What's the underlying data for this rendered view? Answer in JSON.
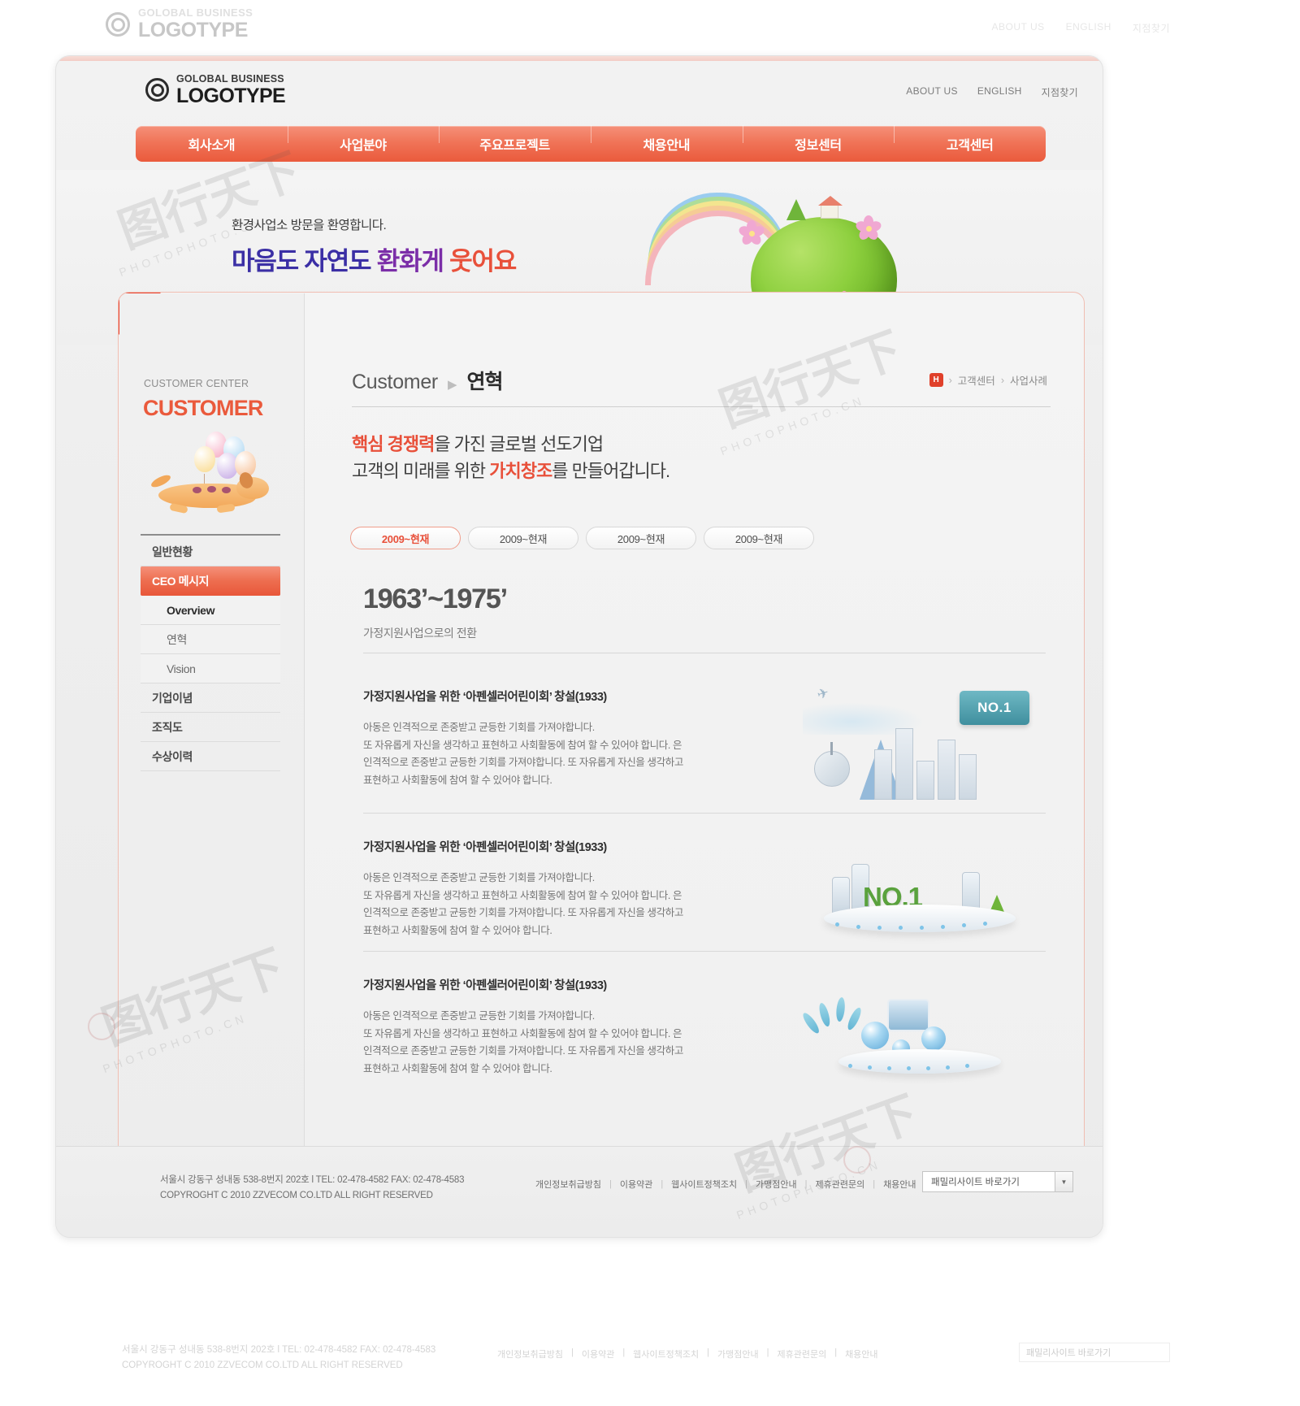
{
  "brand": {
    "logo_sub": "GOLOBAL BUSINESS",
    "logo_main": "LOGOTYPE",
    "accent": "#ea5a3c",
    "accent_dark": "#e0402a"
  },
  "toplinks": [
    {
      "label": "ABOUT US"
    },
    {
      "label": "ENGLISH"
    },
    {
      "label": "지점찾기"
    }
  ],
  "gnb": [
    {
      "label": "회사소개"
    },
    {
      "label": "사업분야"
    },
    {
      "label": "주요프로젝트"
    },
    {
      "label": "채용안내"
    },
    {
      "label": "정보센터"
    },
    {
      "label": "고객센터"
    }
  ],
  "hero": {
    "line1": "환경사업소 방문을 환영합니다.",
    "word1": "마음도",
    "word2": "자연도",
    "word3": "환화게",
    "word4": "웃어요"
  },
  "sidebar": {
    "eyebrow": "CUSTOMER CENTER",
    "title": "CUSTOMER",
    "items": [
      {
        "label": "일반현황",
        "kind": "top"
      },
      {
        "label": "CEO 메시지",
        "kind": "active"
      },
      {
        "label": "Overview",
        "kind": "sub-current"
      },
      {
        "label": "연혁",
        "kind": "sub"
      },
      {
        "label": "Vision",
        "kind": "sub"
      },
      {
        "label": "기업이념",
        "kind": "top"
      },
      {
        "label": "조직도",
        "kind": "top"
      },
      {
        "label": "수상이력",
        "kind": "top"
      }
    ]
  },
  "page": {
    "title_en": "Customer",
    "title_arrow": "▶",
    "title_ko": "연혁",
    "breadcrumb": {
      "home_glyph": "H",
      "sep": "›",
      "items": [
        "고객센터",
        "사업사례"
      ]
    },
    "intro": {
      "l1_red": "핵심 경쟁력",
      "l1_rest": "을 가진 글로벌 선도기업",
      "l2_pre": "고객의 미래를 위한 ",
      "l2_red": "가치창조",
      "l2_rest": "를 만들어갑니다."
    },
    "pills": [
      {
        "label": "2009~현재",
        "active": true
      },
      {
        "label": "2009~현재",
        "active": false
      },
      {
        "label": "2009~현재",
        "active": false
      },
      {
        "label": "2009~현재",
        "active": false
      }
    ],
    "era": {
      "years": "1963’~1975’",
      "subtitle": "가정지원사업으로의 전환"
    },
    "blocks": [
      {
        "title": "가정지원사업을 위한  ‘아펜셀러어린이회’  창설(1933)",
        "body": "아동은 인격적으로 존중받고 균등한 기회를 가져야합니다.\n또 자유롭게 자신을 생각하고 표현하고 사회활동에 참여 할 수 있어야 합니다.  은\n인격적으로 존중받고 균등한 기회를 가져야합니다. 또 자유롭게 자신을 생각하고\n표현하고 사회활동에 참여 할 수 있어야 합니다.",
        "art": "city-no1-sign"
      },
      {
        "title": "가정지원사업을 위한  ‘아펜셀러어린이회’  창설(1933)",
        "body": "아동은 인격적으로 존중받고 균등한 기회를 가져야합니다.\n또 자유롭게 자신을 생각하고 표현하고 사회활동에 참여 할 수 있어야 합니다.  은\n인격적으로 존중받고 균등한 기회를 가져야합니다. 또 자유롭게 자신을 생각하고\n표현하고 사회활동에 참여 할 수 있어야 합니다.",
        "art": "no1-podium"
      },
      {
        "title": "가정지원사업을 위한  ‘아펜셀러어린이회’  창설(1933)",
        "body": "아동은 인격적으로 존중받고 균등한 기회를 가져야합니다.\n또 자유롭게 자신을 생각하고 표현하고 사회활동에 참여 할 수 있어야 합니다.  은\n인격적으로 존중받고 균등한 기회를 가져야합니다. 또 자유롭게 자신을 생각하고\n표현하고 사회활동에 참여 할 수 있어야 합니다.",
        "art": "orbs-podium"
      }
    ],
    "art_labels": {
      "no1_sign": "NO.1",
      "no1_big": "NO,1"
    }
  },
  "footer": {
    "address": "서울시 강동구 성내동 538-8번지 202호 l  TEL: 02-478-4582  FAX: 02-478-4583",
    "copyright": "COPYROGHT C 2010 ZZVECOM CO.LTD   ALL RIGHT RESERVED",
    "links": [
      "개인정보취급방침",
      "이용약관",
      "웹사이트정책조치",
      "가맹점안내",
      "제휴관련문의",
      "채용안내"
    ],
    "select_value": "패밀리사이트 바로가기",
    "select_arrow": "▼"
  }
}
